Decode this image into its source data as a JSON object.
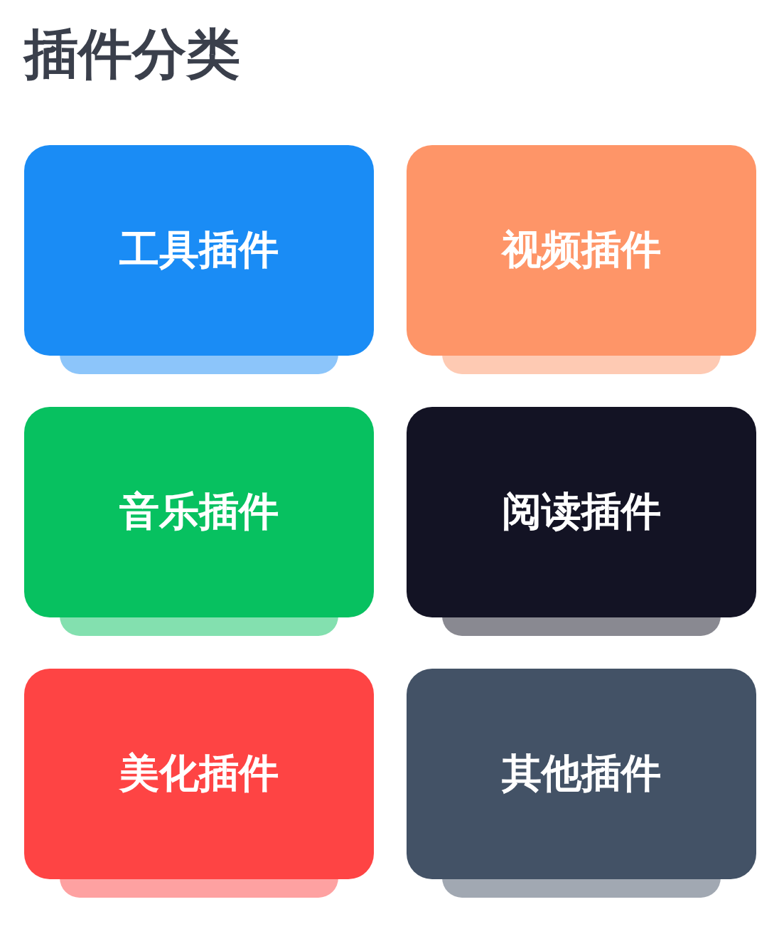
{
  "title": "插件分类",
  "categories": [
    {
      "label": "工具插件",
      "color": "#1a8cf5"
    },
    {
      "label": "视频插件",
      "color": "#fe9568"
    },
    {
      "label": "音乐插件",
      "color": "#07c160"
    },
    {
      "label": "阅读插件",
      "color": "#131324"
    },
    {
      "label": "美化插件",
      "color": "#fe4444"
    },
    {
      "label": "其他插件",
      "color": "#435266"
    }
  ]
}
